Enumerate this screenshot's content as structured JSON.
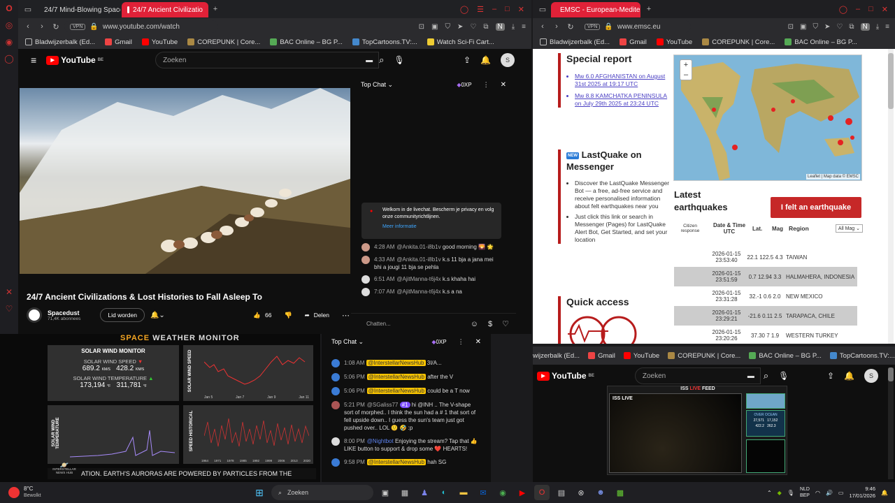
{
  "left_browser": {
    "tabs": [
      {
        "label": "24/7 Mind-Blowing Space"
      },
      {
        "label": "24/7 Ancient Civilizatio"
      }
    ],
    "url": "www.youtube.com/watch",
    "vpn": "VPN",
    "bookmarks": [
      "Bladwijzerbalk (Ed...",
      "Gmail",
      "YouTube",
      "COREPUNK | Core...",
      "BAC Online – BG P...",
      "TopCartoons.TV:...",
      "Watch Sci-Fi Cart..."
    ]
  },
  "youtube": {
    "logo": "YouTube",
    "region": "BE",
    "search_placeholder": "Zoeken",
    "avatar_letter": "S",
    "video_title": "24/7 Ancient Civilizations & Lost Histories to Fall Asleep To",
    "channel": "Spacedust",
    "subscribers": "71,4K abonnees",
    "join_label": "Lid worden",
    "likes": "66",
    "share_label": "Delen",
    "chat": {
      "header": "Top Chat",
      "xp": "0XP",
      "welcome": "Welkom in de livechat. Bescherm je privacy en volg onze communityrichtlijnen.",
      "more_info": "Meer informatie",
      "input_placeholder": "Chatten...",
      "messages": [
        {
          "time": "4:28 AM",
          "user": "@Ankita.01-i8b1v",
          "text": "good morning 🌄 🌟"
        },
        {
          "time": "4:33 AM",
          "user": "@Ankita.01-i8b1v",
          "text": "k.s 11 bja a jana mei bhi a jougi 11 bja se pehla"
        },
        {
          "time": "6:51 AM",
          "user": "@AjitManna-t6j4x",
          "text": "k.s khaha hai"
        },
        {
          "time": "7:07 AM",
          "user": "@AjitManna-t6j4x",
          "text": "k.s a na"
        }
      ]
    }
  },
  "space_weather": {
    "title_a": "SPACE",
    "title_b": "WEATHER MONITOR",
    "monitor_title": "SOLAR WIND MONITOR",
    "speed_label": "SOLAR WIND SPEED",
    "speed_1": "689.2",
    "speed_2": "428.2",
    "speed_unit": "KM/S",
    "temp_label": "SOLAR WIND TEMPERATURE",
    "temp_1": "173,194",
    "temp_2": "311,781",
    "temp_unit": "°F",
    "chart1_label": "SOLAR WIND SPEED",
    "chart1_x": [
      "Jan 5",
      "Jan 7",
      "Jan 9",
      "Jan 11"
    ],
    "chart2_label": "SOLAR WIND TEMPERATURE",
    "chart3_label": "SPEED HISTORICAL",
    "chart3_x": [
      "1964",
      "1971",
      "1978",
      "1985",
      "1992",
      "1999",
      "2006",
      "2013",
      "2020"
    ],
    "ticker": "ATION.   EARTH'S AURORAS ARE POWERED BY PARTICLES FROM THE",
    "brand": "INTERSTELLAR NEWS HUB"
  },
  "chat2": {
    "header": "Top Chat",
    "xp": "0XP",
    "messages": [
      {
        "time": "1:08 AM",
        "user": "@InterstellarNewsHub",
        "text": "3I/A..."
      },
      {
        "time": "5:06 PM",
        "user": "@InterstellarNewsHub",
        "text": "after the V"
      },
      {
        "time": "5:06 PM",
        "user": "@InterstellarNewsHub",
        "text": "could be a T now"
      },
      {
        "time": "5:21 PM",
        "user": "@SGaliss77",
        "badge": "#1",
        "text": "hi @INH .. The V-shape sort of morphed.. I think the sun had a # 1 that sort of fell upside down.. I guess the sun's team just got pushed over.. LOL 🙂 🤣 :p"
      },
      {
        "time": "8:00 PM",
        "user": "@Nightbot",
        "text": "Enjoying the stream? Tap that 👍 LIKE button to support & drop some ❤️ HEARTS!"
      },
      {
        "time": "9:58 PM",
        "user": "@InterstellarNewsHub",
        "text": "hah SG"
      }
    ]
  },
  "right_browser": {
    "tab": "EMSC - European-Mediter",
    "url": "www.emsc.eu",
    "vpn": "VPN",
    "bookmarks": [
      "Bladwijzerbalk (Ed...",
      "Gmail",
      "YouTube",
      "COREPUNK | Core...",
      "BAC Online – BG P..."
    ]
  },
  "emsc": {
    "special_report": "Special report",
    "reports": [
      "Mw 6.0 AFGHANISTAN on August 31st 2025 at 19:17 UTC",
      "Mw 8.8 KAMCHATKA PENINSULA on July 29th 2025 at 23:24 UTC"
    ],
    "lastquake_title": "LastQuake on Messenger",
    "lastquake_badge": "NEW",
    "lastquake_items": [
      "Discover the LastQuake Messenger Bot — a free, ad-free service and receive personalised information about felt earthquakes near you",
      "Just click this link or search in Messenger (Pages) for LastQuake Alert Bot, Get Started, and set your location"
    ],
    "quick_access": "Quick access",
    "map_attribution": "Leaflet | Map data © EMSC",
    "latest_title": "Latest earthquakes",
    "felt_button": "I felt an earthquake",
    "table_headers": [
      "Citizen response",
      "Date & Time UTC",
      "Lat.",
      "Mag",
      "Region"
    ],
    "mag_filter": "All Mag",
    "quakes": [
      {
        "date": "2026-01-15",
        "time": "23:53:40",
        "lat": "22.1",
        "lon": "122.5",
        "mag": "4.3",
        "region": "TAIWAN"
      },
      {
        "date": "2026-01-15",
        "time": "23:51:59",
        "lat": "0.7",
        "lon": "12.94",
        "mag": "3.3",
        "region": "HALMAHERA, INDONESIA"
      },
      {
        "date": "2026-01-15",
        "time": "23:31:28",
        "lat": "32.-1",
        "lon": "0.6",
        "mag": "2.0",
        "region": "NEW MEXICO"
      },
      {
        "date": "2026-01-15",
        "time": "23:29:21",
        "lat": "-21.6",
        "lon": "0.11",
        "mag": "2.5",
        "region": "TARAPACA, CHILE"
      },
      {
        "date": "2026-01-15",
        "time": "23:20:26",
        "lat": "37.30",
        "lon": "7",
        "mag": "1.9",
        "region": "WESTERN TURKEY"
      }
    ]
  },
  "iss": {
    "bookmarks": [
      "wijzerbalk (Ed...",
      "Gmail",
      "YouTube",
      "COREPUNK | Core...",
      "BAC Online – BG P...",
      "TopCartoons.TV:..."
    ],
    "search_placeholder": "Zoeken",
    "logo": "YouTube",
    "region": "BE",
    "avatar_letter": "S",
    "feed_title_a": "ISS",
    "feed_title_b": "LIVE",
    "feed_title_c": "FEED",
    "live_tag": "ISS LIVE",
    "over_label": "OVER OCEAN",
    "stats": [
      "27,571",
      "17,152",
      "422.2",
      "262.3"
    ]
  },
  "taskbar": {
    "weather_temp": "8°C",
    "weather_desc": "Bewolkt",
    "search_label": "Zoeken",
    "lang_1": "NLD",
    "lang_2": "BEP",
    "time": "9:46",
    "date": "17/01/2026"
  }
}
